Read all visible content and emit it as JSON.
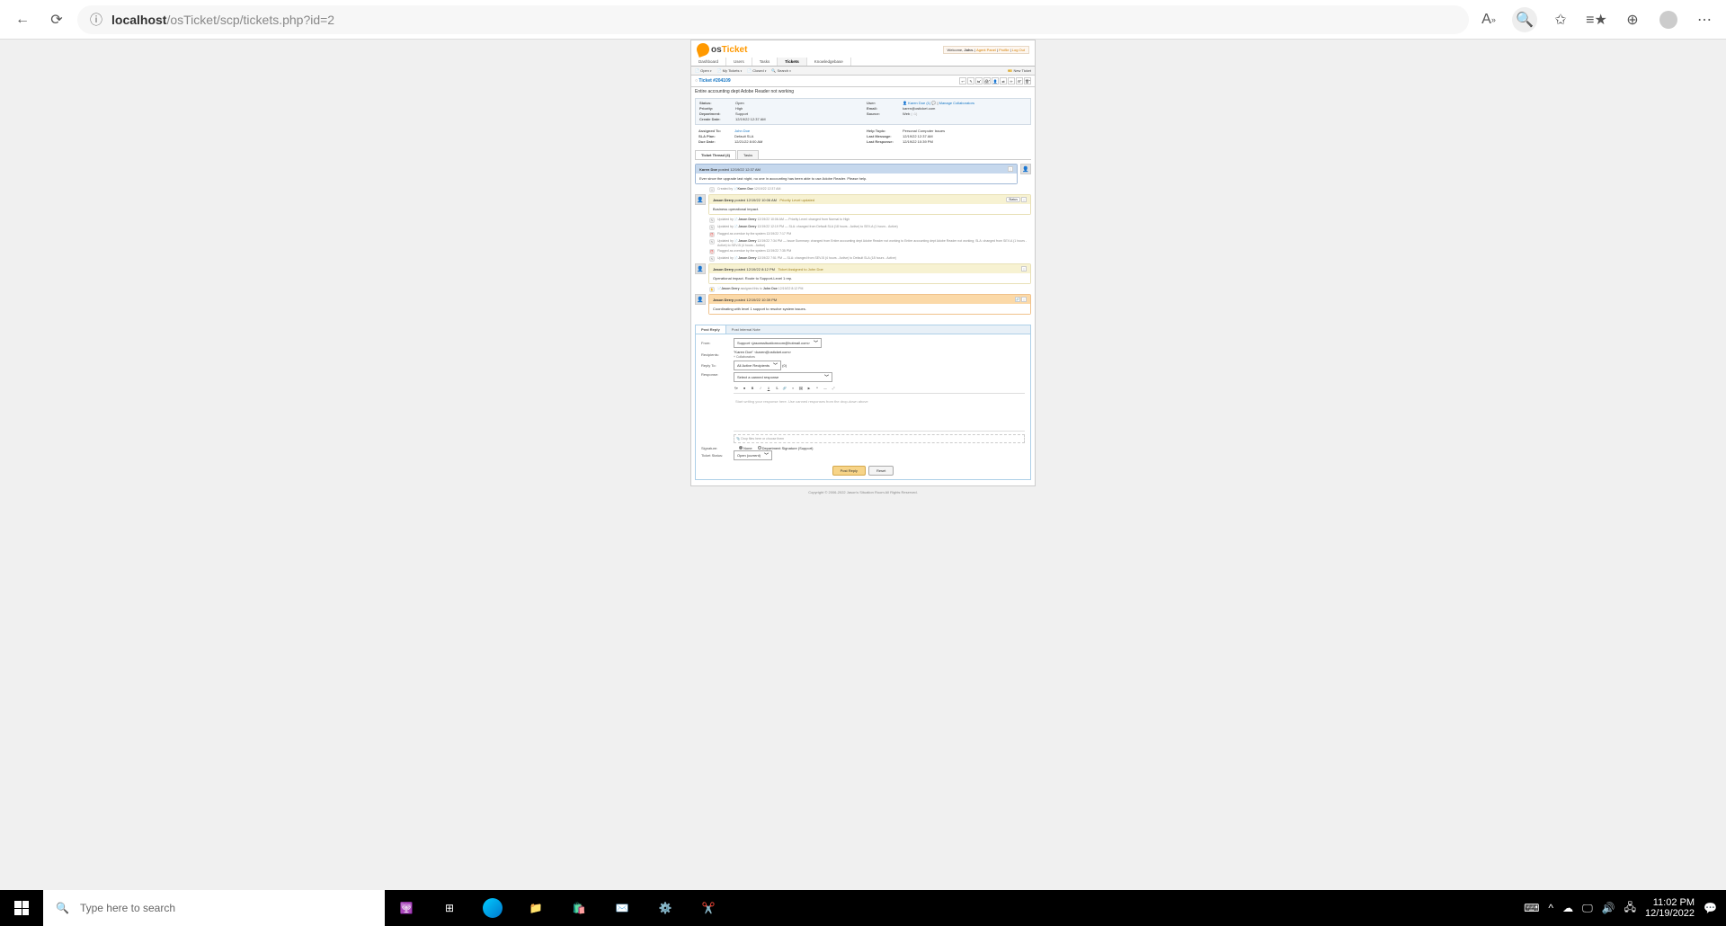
{
  "browser": {
    "url_host": "localhost",
    "url_path": "/osTicket/scp/tickets.php?id=2"
  },
  "header": {
    "welcome_pre": "Welcome, ",
    "welcome_name": "John.",
    "agent_panel": "Agent Panel",
    "profile": "Profile",
    "logout": "Log Out"
  },
  "nav": {
    "dashboard": "Dashboard",
    "users": "Users",
    "tasks": "Tasks",
    "tickets": "Tickets",
    "kb": "Knowledgebase"
  },
  "subnav": {
    "open": "Open",
    "my": "My Tickets",
    "closed": "Closed",
    "search": "Search",
    "new": "New Ticket"
  },
  "ticket": {
    "title_pre": "Ticket #",
    "number": "204109",
    "subject": "Entire accounting dept Adobe Reader not working"
  },
  "info": {
    "status_l": "Status:",
    "status_v": "Open",
    "priority_l": "Priority:",
    "priority_v": "High",
    "dept_l": "Department:",
    "dept_v": "Support",
    "created_l": "Create Date:",
    "created_v": "12/19/22 12:37 AM",
    "user_l": "User:",
    "user_v": "Karen Doe (1)",
    "user_manage": "Manage Collaborators",
    "email_l": "Email:",
    "email_v": "karen@osticket.com",
    "source_l": "Source:",
    "source_v": "Web",
    "source_ip": "(::1)",
    "assigned_l": "Assigned To:",
    "assigned_v": "John Doe",
    "sla_l": "SLA Plan:",
    "sla_v": "Default SLA",
    "due_l": "Due Date:",
    "due_v": "12/21/22 8:00 AM",
    "topic_l": "Help Topic:",
    "topic_v": "Personal Computer Issues",
    "lastmsg_l": "Last Message:",
    "lastmsg_v": "12/19/22 12:37 AM",
    "lastresp_l": "Last Response:",
    "lastresp_v": "12/19/22 10:39 PM"
  },
  "tabs": {
    "thread": "Ticket Thread (4)",
    "tasks": "Tasks"
  },
  "thread": {
    "e1_author": "Karen Doe",
    "posted": "posted",
    "e1_time": "12/19/22 12:37 AM",
    "e1_body": "Ever since the upgrade last night, no one in accounting has been able to use Adobe Reader. Please help.",
    "ev_created_by": "Created by",
    "ev_created_name": "Karen Doe",
    "ev_created_time": "12/19/22 12:37 AM",
    "e2_author": "Jason Derry",
    "e2_time": "12/19/22 10:06 AM",
    "e2_tag": "Priority Level updated",
    "e2_badge": "Status",
    "e2_body": "Business operational impact.",
    "updated_by": "Updated by",
    "ev2_name": "Jason Derry",
    "ev2_time": "12/19/22 10:06 AM",
    "ev2_text": " — Priority Level: changed from Normal to High",
    "ev3_time": "12/19/22 12:19 PM",
    "ev3_text": " — SLA: changed from Default SLA (18 hours - Active) to SEV-A (1 hours - Active)",
    "ev4_text": "Flagged as overdue by the system 12/19/22 7:17 PM",
    "ev5_time": "12/19/22 7:34 PM",
    "ev5_text": " — Issue Summary: changed from Entire accounting dept Adobe Reader not working to Entire accounting dept Adobe Reader not working; SLA: changed from SEV-A (1 hours - Active) to SEV-B (4 hours - Active)",
    "ev6_text": "Flagged as overdue by the system 12/19/22 7:35 PM",
    "ev7_time": "12/19/22 7:51 PM",
    "ev7_text": " — SLA: changed from SEV-B (4 hours - Active) to Default SLA (18 hours - Active)",
    "e3_author": "Jason Derry",
    "e3_time": "12/19/22 8:12 PM",
    "e3_tag": "Ticket Assigned to John Doe",
    "e3_body": "Operational impact. Route to Support-Level 1 rep.",
    "ev8_pre": "Jason Derry",
    "ev8_mid": " assigned this to ",
    "ev8_name": "John Doe",
    "ev8_time": "12/19/22 8:12 PM",
    "e4_author": "Jason Derry",
    "e4_time": "12/19/22 10:39 PM",
    "e4_body": "Coordinating with level 1 support to resolve system issues."
  },
  "reply": {
    "tab_reply": "Post Reply",
    "tab_note": "Post Internal Note",
    "from_l": "From:",
    "from_v": "Support <jasonssituationroom@hotmail.com>",
    "recip_l": "Recipients:",
    "recip_v": "\"Karen Doe\" <karen@osticket.com>",
    "collab": "+ Collaborators",
    "replyto_l": "Reply To:",
    "replyto_v": "All Active Recipients",
    "replyto_count": "(0)",
    "response_l": "Response:",
    "canned": "Select a canned response",
    "placeholder": "Start writing your response here. Use canned responses from the drop-down above",
    "drop": "Drop files here or choose them",
    "sig_l": "Signature:",
    "sig_none": "None",
    "sig_dept": "Department Signature (Support)",
    "status_l": "Ticket Status:",
    "status_v": "Open (current)",
    "post": "Post Reply",
    "reset": "Reset"
  },
  "footer": "Copyright © 2006-2022 Jason's Situation Room All Rights Reserved.",
  "taskbar": {
    "search": "Type here to search",
    "time": "11:02 PM",
    "date": "12/19/2022"
  }
}
